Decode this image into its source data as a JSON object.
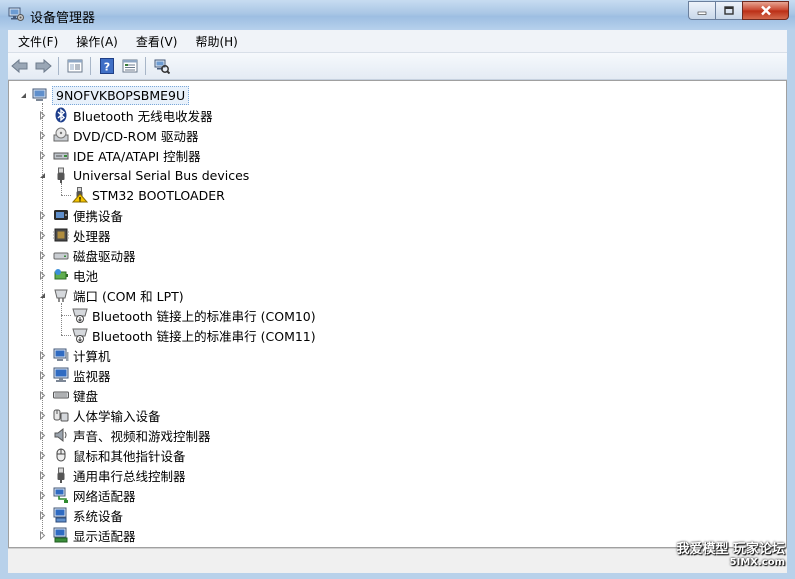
{
  "window": {
    "title": "设备管理器"
  },
  "menu": [
    "文件(F)",
    "操作(A)",
    "查看(V)",
    "帮助(H)"
  ],
  "toolbar": {
    "buttons": [
      "back-icon",
      "forward-icon",
      "properties-panel-icon",
      "help-icon",
      "console-tree-icon",
      "scan-hardware-icon"
    ]
  },
  "tree": {
    "root": "9NOFVKBOPSBME9U",
    "items": [
      {
        "label": "Bluetooth 无线电收发器",
        "icon": "bluetooth-icon",
        "level": 1,
        "expander": "collapsed"
      },
      {
        "label": "DVD/CD-ROM 驱动器",
        "icon": "dvd-drive-icon",
        "level": 1,
        "expander": "collapsed"
      },
      {
        "label": "IDE ATA/ATAPI 控制器",
        "icon": "ide-controller-icon",
        "level": 1,
        "expander": "collapsed"
      },
      {
        "label": "Universal Serial Bus devices",
        "icon": "usb-plug-icon",
        "level": 1,
        "expander": "expanded"
      },
      {
        "label": "STM32  BOOTLOADER",
        "icon": "usb-warning-icon",
        "level": 2,
        "expander": "none"
      },
      {
        "label": "便携设备",
        "icon": "portable-device-icon",
        "level": 1,
        "expander": "collapsed"
      },
      {
        "label": "处理器",
        "icon": "processor-icon",
        "level": 1,
        "expander": "collapsed"
      },
      {
        "label": "磁盘驱动器",
        "icon": "disk-drive-icon",
        "level": 1,
        "expander": "collapsed"
      },
      {
        "label": "电池",
        "icon": "battery-icon",
        "level": 1,
        "expander": "collapsed"
      },
      {
        "label": "端口 (COM 和 LPT)",
        "icon": "port-icon",
        "level": 1,
        "expander": "expanded"
      },
      {
        "label": "Bluetooth 链接上的标准串行 (COM10)",
        "icon": "serial-port-icon",
        "level": 2,
        "expander": "none"
      },
      {
        "label": "Bluetooth 链接上的标准串行 (COM11)",
        "icon": "serial-port-icon",
        "level": 2,
        "expander": "none"
      },
      {
        "label": "计算机",
        "icon": "computer-icon",
        "level": 1,
        "expander": "collapsed"
      },
      {
        "label": "监视器",
        "icon": "monitor-icon",
        "level": 1,
        "expander": "collapsed"
      },
      {
        "label": "键盘",
        "icon": "keyboard-icon",
        "level": 1,
        "expander": "collapsed"
      },
      {
        "label": "人体学输入设备",
        "icon": "hid-icon",
        "level": 1,
        "expander": "collapsed"
      },
      {
        "label": "声音、视频和游戏控制器",
        "icon": "sound-icon",
        "level": 1,
        "expander": "collapsed"
      },
      {
        "label": "鼠标和其他指针设备",
        "icon": "mouse-icon",
        "level": 1,
        "expander": "collapsed"
      },
      {
        "label": "通用串行总线控制器",
        "icon": "usb-controller-icon",
        "level": 1,
        "expander": "collapsed"
      },
      {
        "label": "网络适配器",
        "icon": "network-adapter-icon",
        "level": 1,
        "expander": "collapsed"
      },
      {
        "label": "系统设备",
        "icon": "system-device-icon",
        "level": 1,
        "expander": "collapsed"
      },
      {
        "label": "显示适配器",
        "icon": "display-adapter-icon",
        "level": 1,
        "expander": "collapsed"
      }
    ]
  },
  "watermark": {
    "line1": "我爱模型 玩家论坛",
    "line2": "5IMX.com"
  }
}
